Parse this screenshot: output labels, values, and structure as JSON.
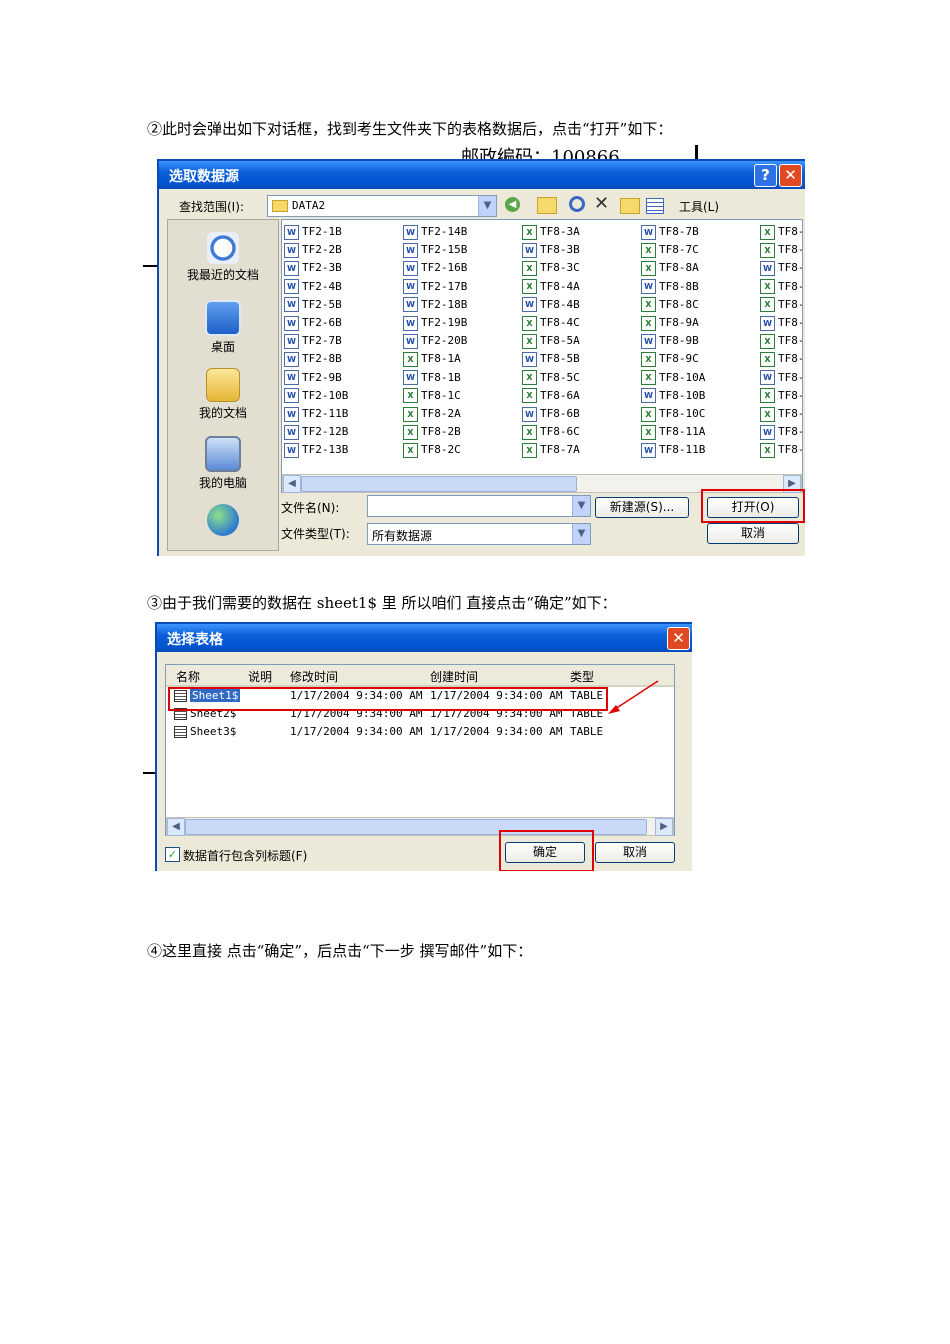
{
  "paragraphs": {
    "p2": "②此时会弹出如下对话框，找到考生文件夹下的表格数据后，点击“打开”如下：",
    "p3": "③由于我们需要的数据在 sheet1$  里  所以咱们  直接点击“确定”如下：",
    "p4": "④这里直接  点击“确定”，后点击“下一步  撰写邮件”如下："
  },
  "background_text": "邮政编码：100866",
  "dialog1": {
    "title": "选取数据源",
    "help": "?",
    "close": "✕",
    "lookin_label": "查找范围(I):",
    "lookin_value": "DATA2",
    "tools_label": "工具(L)",
    "places": [
      "我最近的文档",
      "桌面",
      "我的文档",
      "我的电脑"
    ],
    "files": [
      [
        {
          "n": "TF2-1B",
          "t": "w"
        },
        {
          "n": "TF2-2B",
          "t": "w"
        },
        {
          "n": "TF2-3B",
          "t": "w"
        },
        {
          "n": "TF2-4B",
          "t": "w"
        },
        {
          "n": "TF2-5B",
          "t": "w"
        },
        {
          "n": "TF2-6B",
          "t": "w"
        },
        {
          "n": "TF2-7B",
          "t": "w"
        },
        {
          "n": "TF2-8B",
          "t": "w"
        },
        {
          "n": "TF2-9B",
          "t": "w"
        },
        {
          "n": "TF2-10B",
          "t": "w"
        },
        {
          "n": "TF2-11B",
          "t": "w"
        },
        {
          "n": "TF2-12B",
          "t": "w"
        },
        {
          "n": "TF2-13B",
          "t": "w"
        }
      ],
      [
        {
          "n": "TF2-14B",
          "t": "w"
        },
        {
          "n": "TF2-15B",
          "t": "w"
        },
        {
          "n": "TF2-16B",
          "t": "w"
        },
        {
          "n": "TF2-17B",
          "t": "w"
        },
        {
          "n": "TF2-18B",
          "t": "w"
        },
        {
          "n": "TF2-19B",
          "t": "w"
        },
        {
          "n": "TF2-20B",
          "t": "w"
        },
        {
          "n": "TF8-1A",
          "t": "x"
        },
        {
          "n": "TF8-1B",
          "t": "w"
        },
        {
          "n": "TF8-1C",
          "t": "x"
        },
        {
          "n": "TF8-2A",
          "t": "x"
        },
        {
          "n": "TF8-2B",
          "t": "x"
        },
        {
          "n": "TF8-2C",
          "t": "x"
        }
      ],
      [
        {
          "n": "TF8-3A",
          "t": "x"
        },
        {
          "n": "TF8-3B",
          "t": "w"
        },
        {
          "n": "TF8-3C",
          "t": "x"
        },
        {
          "n": "TF8-4A",
          "t": "x"
        },
        {
          "n": "TF8-4B",
          "t": "w"
        },
        {
          "n": "TF8-4C",
          "t": "x"
        },
        {
          "n": "TF8-5A",
          "t": "x"
        },
        {
          "n": "TF8-5B",
          "t": "w"
        },
        {
          "n": "TF8-5C",
          "t": "x"
        },
        {
          "n": "TF8-6A",
          "t": "x"
        },
        {
          "n": "TF8-6B",
          "t": "w"
        },
        {
          "n": "TF8-6C",
          "t": "x"
        },
        {
          "n": "TF8-7A",
          "t": "x"
        }
      ],
      [
        {
          "n": "TF8-7B",
          "t": "w"
        },
        {
          "n": "TF8-7C",
          "t": "x"
        },
        {
          "n": "TF8-8A",
          "t": "x"
        },
        {
          "n": "TF8-8B",
          "t": "w"
        },
        {
          "n": "TF8-8C",
          "t": "x"
        },
        {
          "n": "TF8-9A",
          "t": "x"
        },
        {
          "n": "TF8-9B",
          "t": "w"
        },
        {
          "n": "TF8-9C",
          "t": "x"
        },
        {
          "n": "TF8-10A",
          "t": "x"
        },
        {
          "n": "TF8-10B",
          "t": "w"
        },
        {
          "n": "TF8-10C",
          "t": "x"
        },
        {
          "n": "TF8-11A",
          "t": "x"
        },
        {
          "n": "TF8-11B",
          "t": "w"
        }
      ],
      [
        {
          "n": "TF8-",
          "t": "x"
        },
        {
          "n": "TF8-",
          "t": "x"
        },
        {
          "n": "TF8-",
          "t": "w"
        },
        {
          "n": "TF8-",
          "t": "x"
        },
        {
          "n": "TF8-",
          "t": "x"
        },
        {
          "n": "TF8-",
          "t": "w"
        },
        {
          "n": "TF8-",
          "t": "x"
        },
        {
          "n": "TF8-",
          "t": "x"
        },
        {
          "n": "TF8-",
          "t": "w"
        },
        {
          "n": "TF8-",
          "t": "x"
        },
        {
          "n": "TF8-",
          "t": "x"
        },
        {
          "n": "TF8-",
          "t": "w"
        },
        {
          "n": "TF8-",
          "t": "x"
        }
      ]
    ],
    "filename_label": "文件名(N):",
    "filename_value": "",
    "filetype_label": "文件类型(T):",
    "filetype_value": "所有数据源",
    "new_source_button": "新建源(S)...",
    "open_button": "打开(O)",
    "cancel_button": "取消"
  },
  "dialog2": {
    "title": "选择表格",
    "close": "✕",
    "columns": [
      "名称",
      "说明",
      "修改时间",
      "创建时间",
      "类型"
    ],
    "rows": [
      {
        "name": "Sheet1$",
        "desc": "",
        "modified": "1/17/2004 9:34:00 AM",
        "created": "1/17/2004 9:34:00 AM",
        "type": "TABLE",
        "selected": true
      },
      {
        "name": "Sheet2$",
        "desc": "",
        "modified": "1/17/2004 9:34:00 AM",
        "created": "1/17/2004 9:34:00 AM",
        "type": "TABLE",
        "selected": false
      },
      {
        "name": "Sheet3$",
        "desc": "",
        "modified": "1/17/2004 9:34:00 AM",
        "created": "1/17/2004 9:34:00 AM",
        "type": "TABLE",
        "selected": false
      }
    ],
    "checkbox_label": "数据首行包含列标题(F)",
    "checkbox_checked": true,
    "ok_button": "确定",
    "cancel_button": "取消"
  },
  "colors": {
    "xp_blue": "#0454d1",
    "highlight_red": "#e00000",
    "selection_blue": "#316ac5"
  }
}
